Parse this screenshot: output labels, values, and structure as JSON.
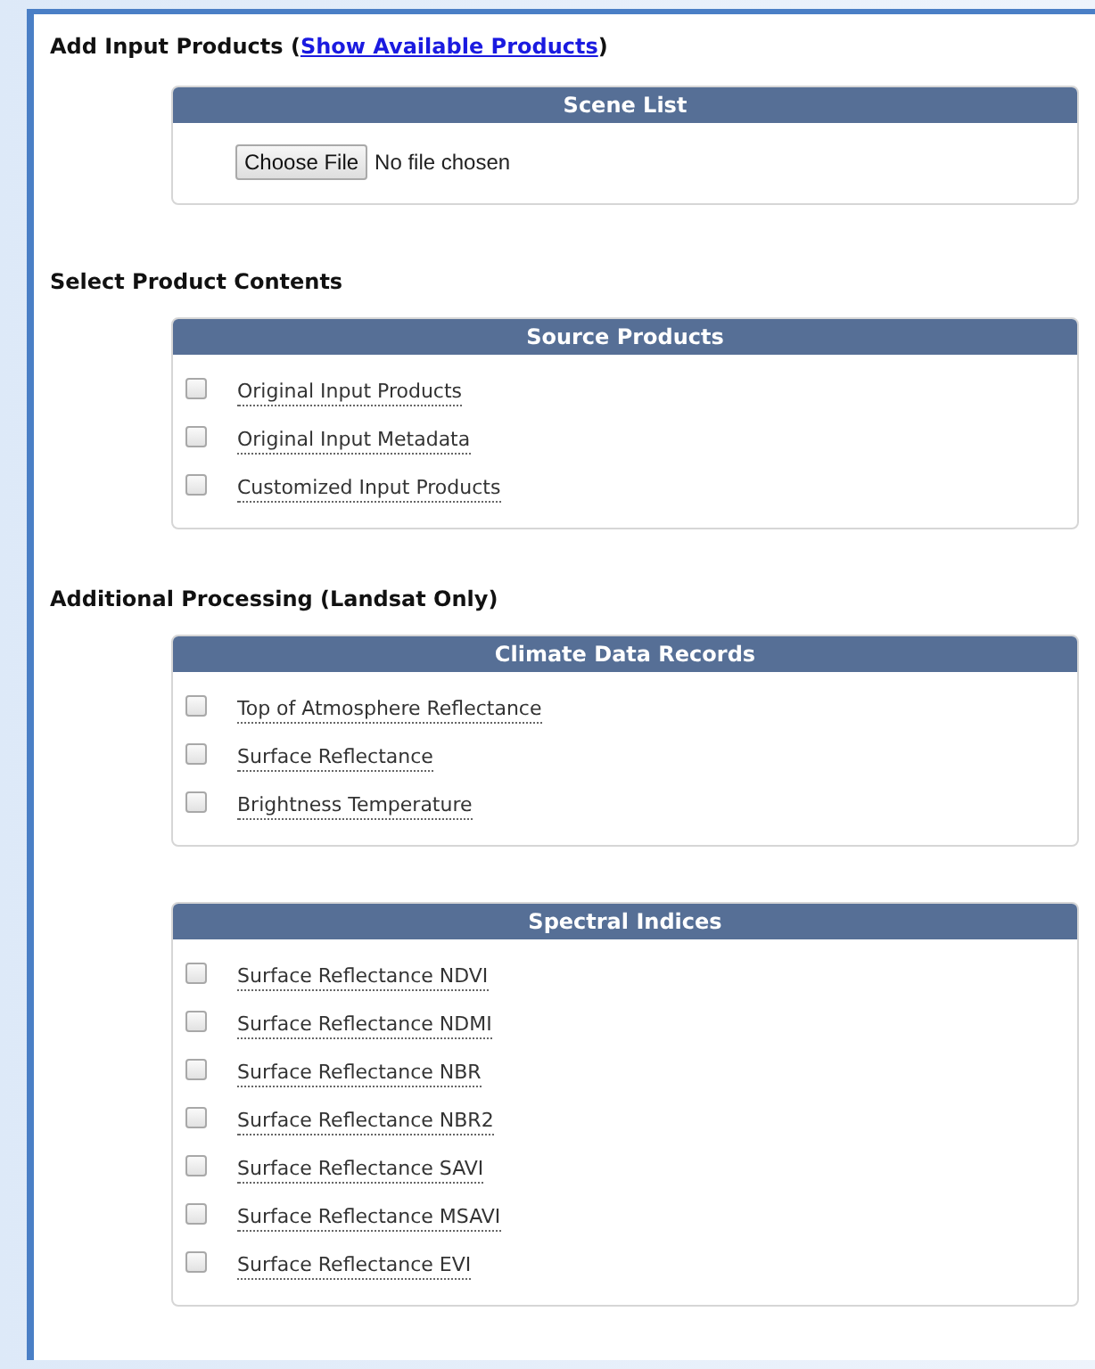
{
  "sections": [
    {
      "heading": "Add Input Products (",
      "link": "Show Available Products",
      "heading_end": ")",
      "panels": [
        {
          "title": "Scene List",
          "kind": "file",
          "button": "Choose File",
          "status": "No file chosen"
        }
      ]
    },
    {
      "heading": "Select Product Contents",
      "panels": [
        {
          "title": "Source Products",
          "kind": "checkboxes",
          "items": [
            {
              "label": "Original Input Products",
              "checked": false
            },
            {
              "label": "Original Input Metadata",
              "checked": false
            },
            {
              "label": "Customized Input Products",
              "checked": false
            }
          ]
        }
      ]
    },
    {
      "heading": "Additional Processing (Landsat Only)",
      "panels": [
        {
          "title": "Climate Data Records",
          "kind": "checkboxes",
          "items": [
            {
              "label": "Top of Atmosphere Reflectance",
              "checked": false
            },
            {
              "label": "Surface Reflectance",
              "checked": false
            },
            {
              "label": "Brightness Temperature",
              "checked": false
            }
          ]
        },
        {
          "title": "Spectral Indices",
          "kind": "checkboxes",
          "items": [
            {
              "label": "Surface Reflectance NDVI",
              "checked": false
            },
            {
              "label": "Surface Reflectance NDMI",
              "checked": false
            },
            {
              "label": "Surface Reflectance NBR",
              "checked": false
            },
            {
              "label": "Surface Reflectance NBR2",
              "checked": false
            },
            {
              "label": "Surface Reflectance SAVI",
              "checked": false
            },
            {
              "label": "Surface Reflectance MSAVI",
              "checked": false
            },
            {
              "label": "Surface Reflectance EVI",
              "checked": false
            }
          ]
        }
      ]
    }
  ]
}
